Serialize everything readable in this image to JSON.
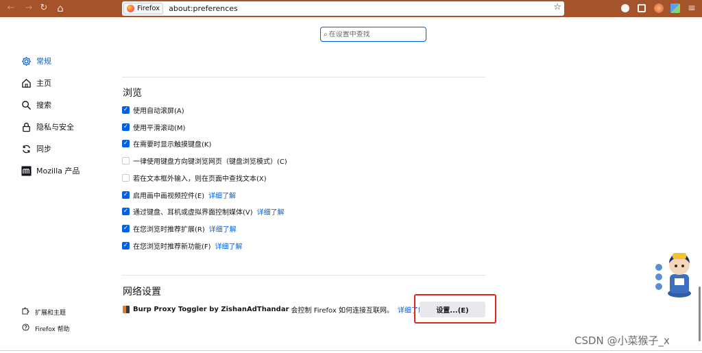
{
  "toolbar": {
    "back_icon": "←",
    "forward_icon": "→",
    "reload_icon": "↻",
    "home_icon": "⌂",
    "identity_label": "Firefox",
    "url": "about:preferences",
    "bookmark_icon": "☆",
    "accent": "#a4532b"
  },
  "search": {
    "placeholder": "在设置中查找"
  },
  "sidebar": {
    "items": [
      {
        "label": "常规",
        "icon": "gear-icon"
      },
      {
        "label": "主页",
        "icon": "home-icon"
      },
      {
        "label": "搜索",
        "icon": "search-icon"
      },
      {
        "label": "隐私与安全",
        "icon": "lock-icon"
      },
      {
        "label": "同步",
        "icon": "sync-icon"
      },
      {
        "label": "Mozilla 产品",
        "icon": "mozilla-icon"
      }
    ],
    "footer": [
      {
        "label": "扩展和主题",
        "icon": "puzzle-icon"
      },
      {
        "label": "Firefox 帮助",
        "icon": "help-icon"
      }
    ]
  },
  "browsing": {
    "heading": "浏览",
    "options": [
      {
        "label": "使用自动滚屏(A)",
        "checked": true,
        "learn_more": ""
      },
      {
        "label": "使用平滑滚动(M)",
        "checked": true,
        "learn_more": ""
      },
      {
        "label": "在需要时显示触摸键盘(K)",
        "checked": true,
        "learn_more": ""
      },
      {
        "label": "一律使用键盘方向键浏览网页（键盘浏览模式）(C)",
        "checked": false,
        "learn_more": ""
      },
      {
        "label": "若在文本框外输入，则在页面中查找文本(X)",
        "checked": false,
        "learn_more": ""
      },
      {
        "label": "启用画中画视频控件(E)",
        "checked": true,
        "learn_more": "详细了解"
      },
      {
        "label": "通过键盘、耳机或虚拟界面控制媒体(V)",
        "checked": true,
        "learn_more": "详细了解"
      },
      {
        "label": "在您浏览时推荐扩展(R)",
        "checked": true,
        "learn_more": "详细了解"
      },
      {
        "label": "在您浏览时推荐新功能(F)",
        "checked": true,
        "learn_more": "详细了解"
      }
    ]
  },
  "network": {
    "heading": "网络设置",
    "extension_name": "Burp Proxy Toggler by ZishanAdThandar",
    "extension_text": "会控制 Firefox 如何连接互联网。",
    "learn_more": "详细了解",
    "settings_button": "设置...(E)"
  },
  "watermark": "CSDN @小菜猴子_x"
}
